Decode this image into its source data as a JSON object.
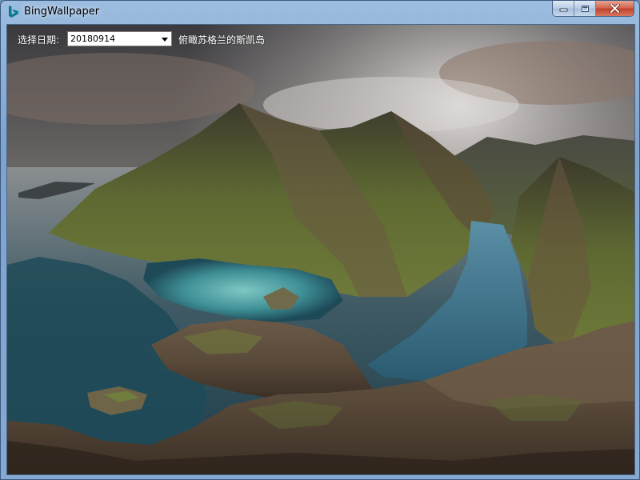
{
  "window": {
    "title": "BingWallpaper",
    "icon": "bing-logo-icon",
    "controls": {
      "minimize": "minimize-icon",
      "maximize": "maximize-icon",
      "close": "close-icon"
    }
  },
  "toolbar": {
    "date_label": "选择日期:",
    "selected_date": "20180914",
    "caption": "俯瞰苏格兰的斯凯岛"
  },
  "colors": {
    "bing_logo": "#0a7a8c",
    "close_button": "#c8452c"
  }
}
